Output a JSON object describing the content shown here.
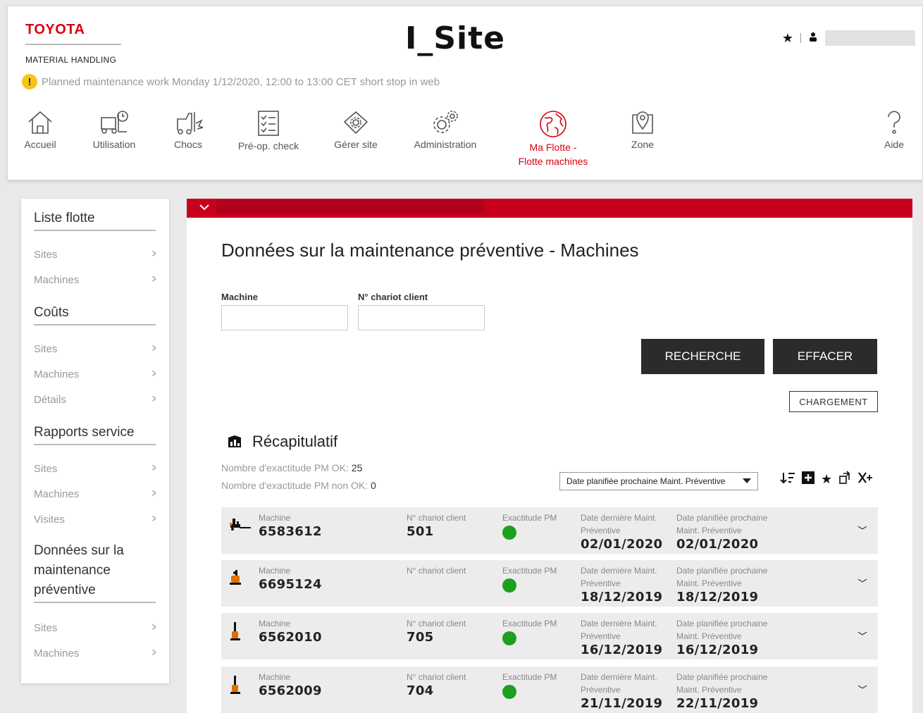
{
  "brand": {
    "name": "TOYOTA",
    "subtitle": "MATERIAL HANDLING"
  },
  "app_title": "I_Site",
  "notice": "Planned maintenance work Monday 1/12/2020, 12:00 to 13:00 CET short stop in web",
  "nav": [
    {
      "label": "Accueil",
      "icon": "home-icon"
    },
    {
      "label": "Utilisation",
      "icon": "forklift-clock-icon"
    },
    {
      "label": "Chocs",
      "icon": "forklift-impact-icon"
    },
    {
      "label": "Pré-op. check",
      "icon": "checklist-icon"
    },
    {
      "label": "Gérer site",
      "icon": "house-gear-icon"
    },
    {
      "label": "Administration",
      "icon": "gears-icon"
    },
    {
      "label": "Ma Flotte -",
      "label2": "Flotte machines",
      "icon": "globe-icon",
      "active": true
    },
    {
      "label": "Zone",
      "icon": "map-pin-icon"
    },
    {
      "label": "Aide",
      "icon": "question-icon"
    }
  ],
  "sidebar": {
    "sections": [
      {
        "title": "Liste flotte",
        "items": [
          "Sites",
          "Machines"
        ]
      },
      {
        "title": "Coûts",
        "items": [
          "Sites",
          "Machines",
          "Détails"
        ]
      },
      {
        "title": "Rapports service",
        "items": [
          "Sites",
          "Machines",
          "Visites"
        ]
      },
      {
        "title_lines": [
          "Données sur la",
          "maintenance",
          "préventive"
        ],
        "items": [
          "Sites",
          "Machines"
        ]
      }
    ]
  },
  "main": {
    "title": "Données sur la maintenance préventive - Machines",
    "fields": {
      "machine_label": "Machine",
      "machine_value": "",
      "client_label": "N° chariot client",
      "client_value": ""
    },
    "buttons": {
      "search": "RECHERCHE",
      "clear": "EFFACER",
      "load": "CHARGEMENT"
    },
    "summary": {
      "title": "Récapitulatif",
      "ok_label": "Nombre d'exactitude PM OK:",
      "ok_value": "25",
      "nok_label": "Nombre d'exactitude PM non OK:",
      "nok_value": "0"
    },
    "sort": {
      "selected": "Date planifiée prochaine Maint. Préventive"
    },
    "tools": [
      "sort-icon",
      "add-box-icon",
      "star-icon",
      "export-icon",
      "excel-icon"
    ],
    "columns": {
      "machine": "Machine",
      "client": "N° chariot client",
      "pm": "Exactitude PM",
      "last1": "Date dernière Maint.",
      "last2": "Préventive",
      "next1": "Date planifiée prochaine",
      "next2": "Maint. Préventive"
    },
    "rows": [
      {
        "machine": "6583612",
        "client": "501",
        "pm_ok": true,
        "last": "02/01/2020",
        "next": "02/01/2020",
        "icon": "pallet-truck-icon"
      },
      {
        "machine": "6695124",
        "client": "",
        "pm_ok": true,
        "last": "18/12/2019",
        "next": "18/12/2019",
        "icon": "stacker-icon"
      },
      {
        "machine": "6562010",
        "client": "705",
        "pm_ok": true,
        "last": "16/12/2019",
        "next": "16/12/2019",
        "icon": "reach-truck-icon"
      },
      {
        "machine": "6562009",
        "client": "704",
        "pm_ok": true,
        "last": "21/11/2019",
        "next": "22/11/2019",
        "icon": "reach-truck-icon"
      }
    ]
  },
  "colors": {
    "brand_red": "#d7000f",
    "banner_red": "#c8001e",
    "ok_green": "#1da01d",
    "button_dark": "#2b2b2b"
  }
}
